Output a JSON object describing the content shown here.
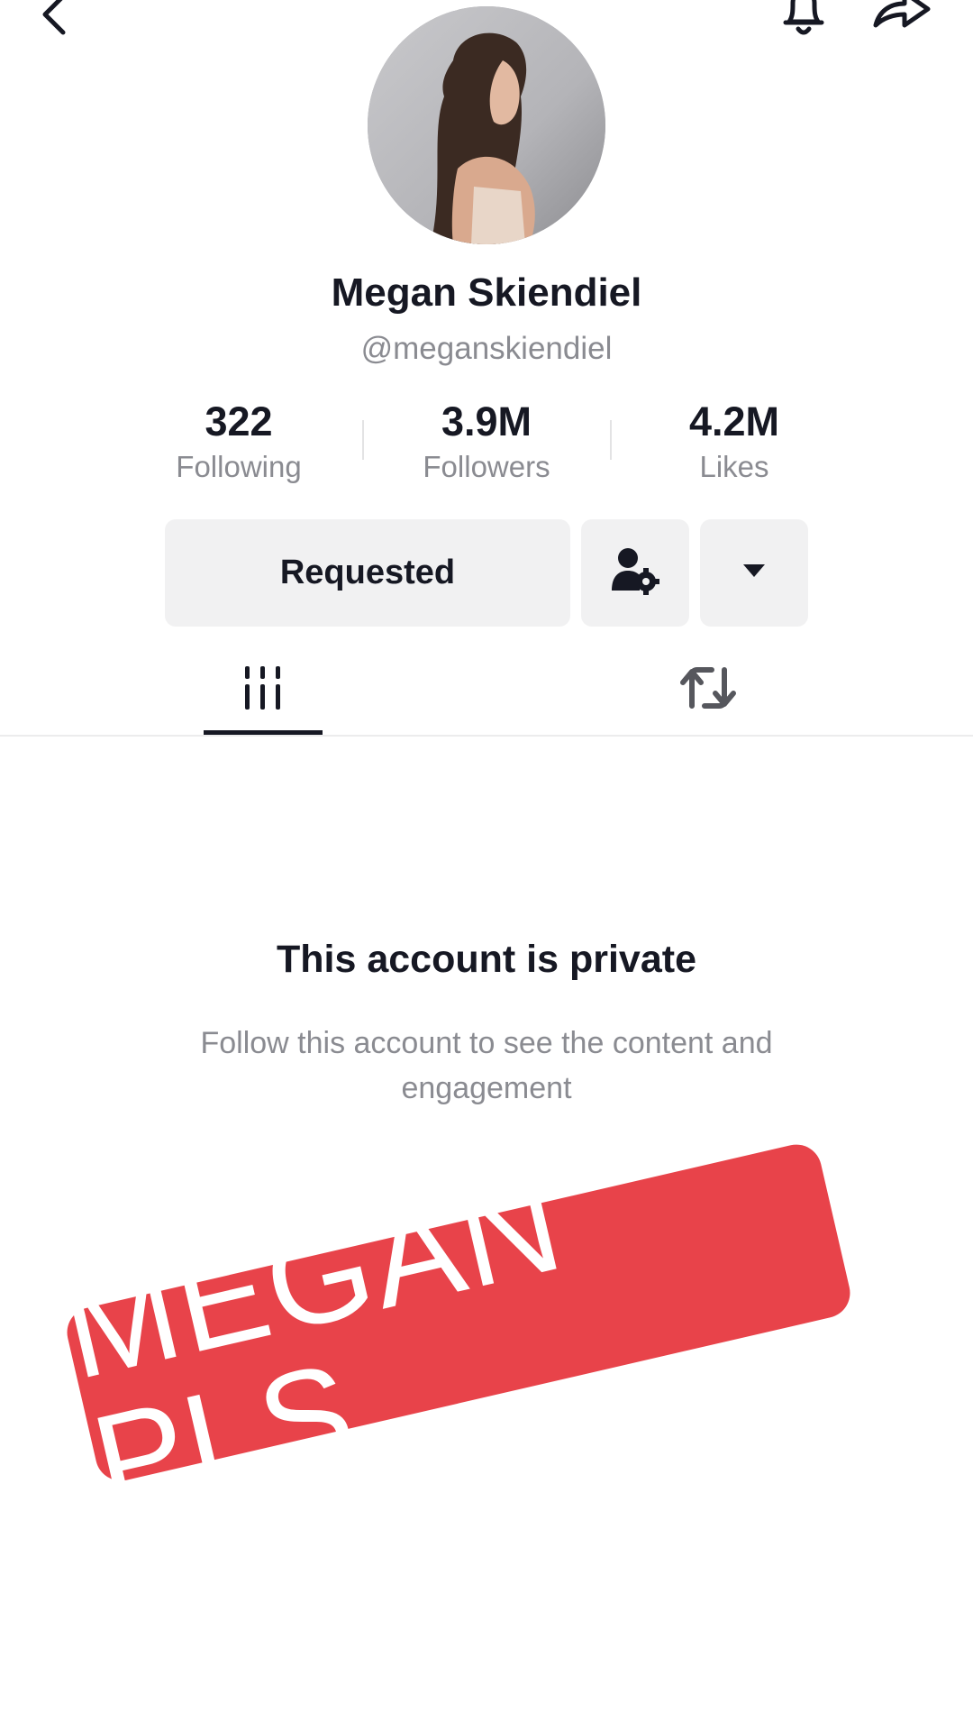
{
  "header": {
    "back_icon": "chevron-left-icon",
    "bell_icon": "bell-icon",
    "share_icon": "share-arrow-icon"
  },
  "profile": {
    "display_name": "Megan Skiendiel",
    "username": "@meganskiendiel"
  },
  "stats": [
    {
      "value": "322",
      "label": "Following"
    },
    {
      "value": "3.9M",
      "label": "Followers"
    },
    {
      "value": "4.2M",
      "label": "Likes"
    }
  ],
  "actions": {
    "requested_label": "Requested",
    "suggest_icon": "person-settings-icon",
    "more_icon": "caret-down-icon"
  },
  "tabs": [
    {
      "icon": "videos-grid-icon",
      "selected": true
    },
    {
      "icon": "repost-icon",
      "selected": false
    }
  ],
  "private_notice": {
    "title": "This account is private",
    "description": "Follow this account to see the content and engagement"
  },
  "sticker": {
    "text": "MEGAN PLS",
    "color": "#e8434a"
  }
}
